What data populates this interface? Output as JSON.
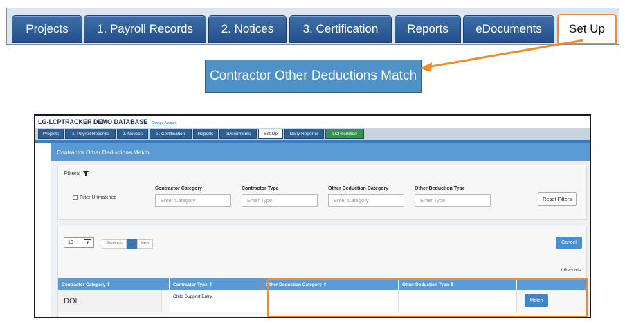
{
  "top_tabs": [
    {
      "label": "Projects"
    },
    {
      "label": "1. Payroll Records"
    },
    {
      "label": "2. Notices"
    },
    {
      "label": "3. Certification"
    },
    {
      "label": "Reports"
    },
    {
      "label": "eDocuments"
    },
    {
      "label": "Set Up",
      "active": true
    }
  ],
  "callout": {
    "label": "Contractor Other Deductions Match"
  },
  "screen": {
    "db_title": "LG-LCPTRACKER DEMO DATABASE",
    "change_account": "Change Account",
    "tabs": [
      "Projects",
      "1. Payroll Records",
      "2. Notices",
      "3. Certification",
      "Reports",
      "eDocuments",
      "Set Up",
      "Daily Reporter",
      "LCPcertified"
    ],
    "page_title": "Contractor Other Deductions Match",
    "filters": {
      "title": "Filters",
      "filter_unmatched": "Filter Unmatched",
      "fields": [
        {
          "label": "Contractor Category",
          "placeholder": "Enter Category"
        },
        {
          "label": "Contractor Type",
          "placeholder": "Enter Type"
        },
        {
          "label": "Other Deduction Category",
          "placeholder": "Enter Category"
        },
        {
          "label": "Other Deduction Type",
          "placeholder": "Enter Type"
        }
      ],
      "reset_label": "Reset Filters"
    },
    "pagination": {
      "page_size": "10",
      "previous": "Previous",
      "current": "1",
      "next": "Next"
    },
    "cancel_label": "Cancel",
    "records_count": "1 Records",
    "table": {
      "columns": [
        "Contractor Category ⇕",
        "Contractor Type ⇕",
        "Other Deduction Category ⇕",
        "Other Deduction Type ⇕",
        ""
      ],
      "rows": [
        {
          "contractor_category": "DOL",
          "contractor_type": "Child Support Entry",
          "other_deduction_category": "",
          "other_deduction_type": "",
          "action": "Match"
        }
      ]
    }
  },
  "colors": {
    "highlight": "#f08a2e",
    "tab_blue": "#24508a",
    "header_blue": "#5b9bd5"
  }
}
